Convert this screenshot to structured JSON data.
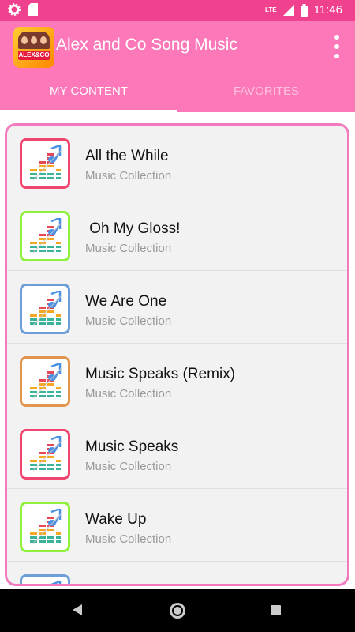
{
  "status_bar": {
    "time": "11:46",
    "network": "LTE",
    "icons": [
      "settings-icon",
      "sd-card-icon",
      "signal-icon",
      "battery-icon"
    ]
  },
  "app_bar": {
    "title": "Alex and Co Song Music",
    "logo_text": "ALEX&CO",
    "menu_icon": "more-vert-icon"
  },
  "tabs": [
    {
      "label": "MY CONTENT",
      "active": true
    },
    {
      "label": "FAVORITES",
      "active": false
    }
  ],
  "songs": [
    {
      "title": "All the While",
      "subtitle": "Music Collection",
      "border_color": "#f0456e"
    },
    {
      "title": " Oh My Gloss!",
      "subtitle": "Music Collection",
      "border_color": "#8ef23c"
    },
    {
      "title": "We Are One",
      "subtitle": "Music Collection",
      "border_color": "#6d9fd6"
    },
    {
      "title": "Music Speaks (Remix)",
      "subtitle": "Music Collection",
      "border_color": "#e2954d"
    },
    {
      "title": "Music Speaks",
      "subtitle": "Music Collection",
      "border_color": "#f0456e"
    },
    {
      "title": "Wake Up",
      "subtitle": "Music Collection",
      "border_color": "#8ef23c"
    },
    {
      "title": "",
      "subtitle": "",
      "border_color": "#6d9fd6"
    }
  ],
  "colors": {
    "status_bar": "#f0418f",
    "app_bar": "#fc78b9",
    "list_border": "#f27bbf"
  },
  "nav_bar": {
    "icons": [
      "back-icon",
      "home-icon",
      "recents-icon"
    ]
  }
}
